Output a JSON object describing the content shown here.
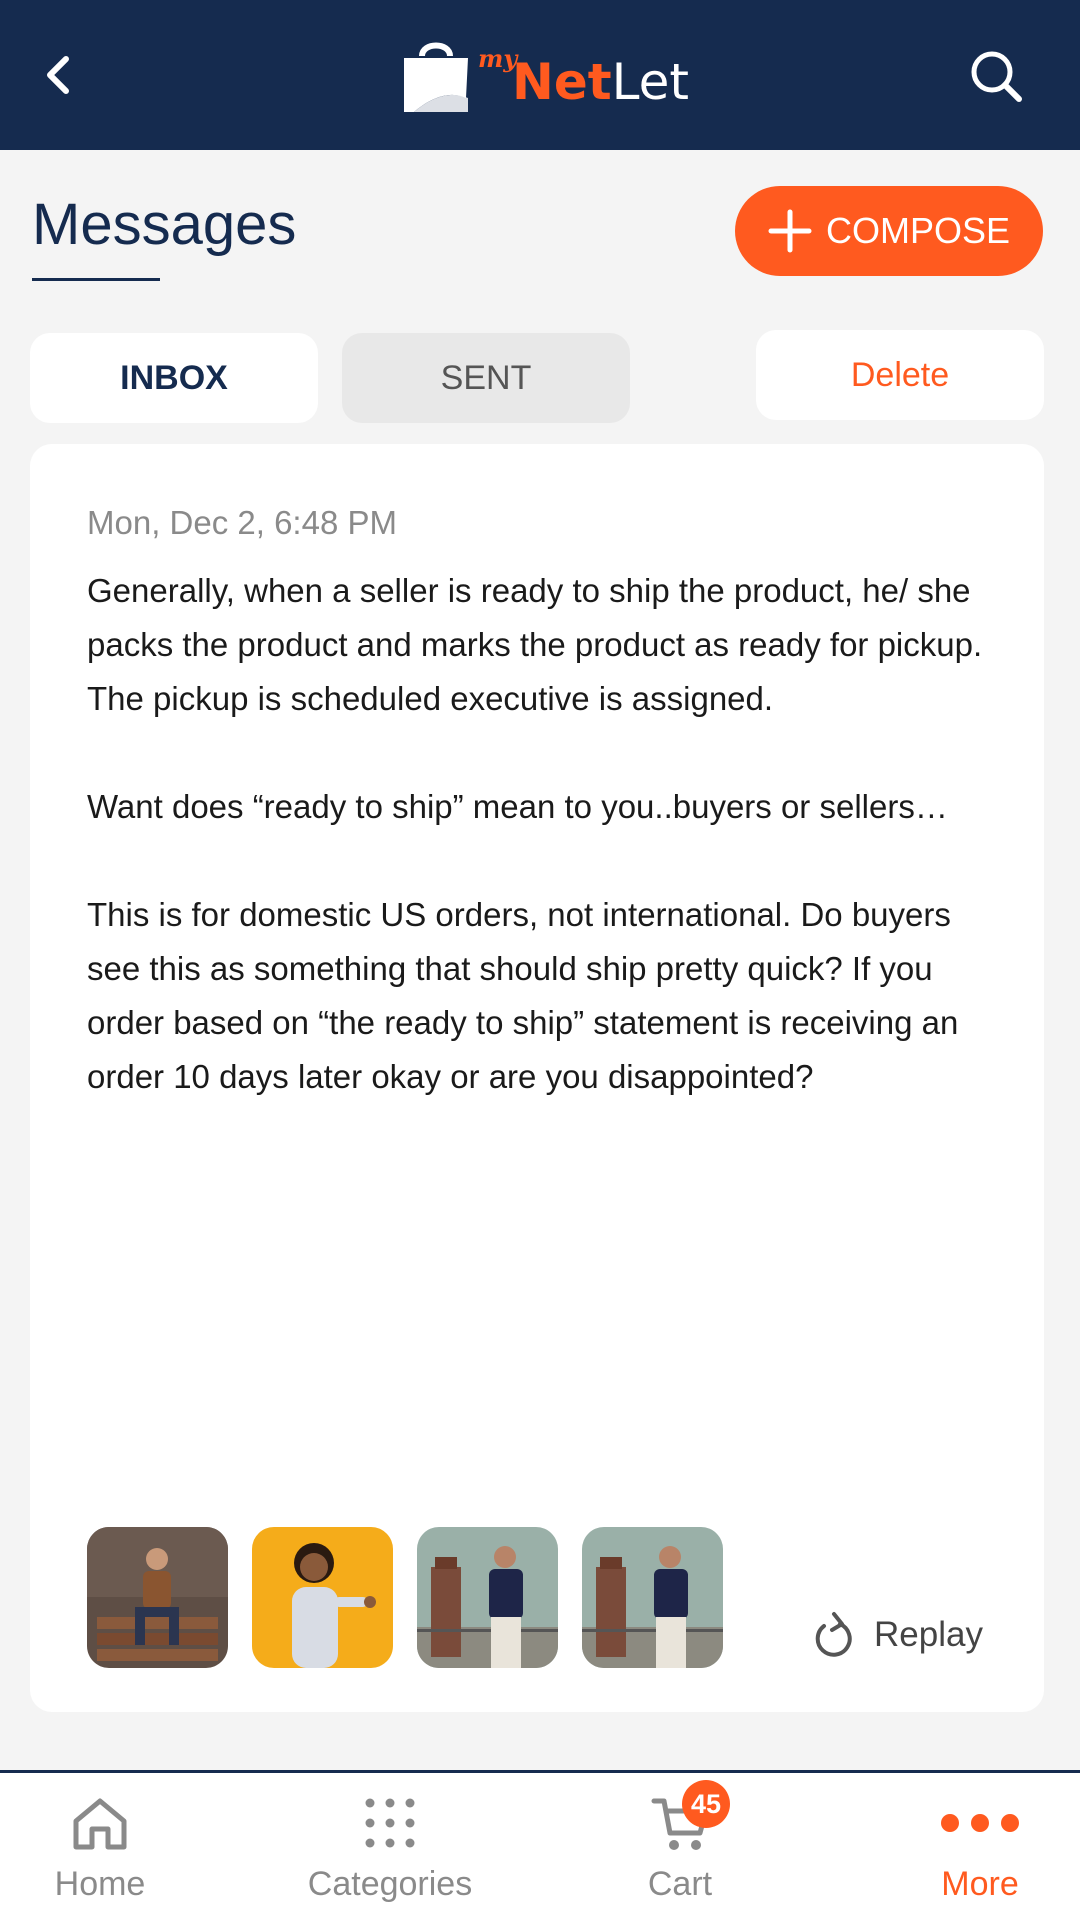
{
  "header": {
    "logo": {
      "prefix": "my",
      "brand_accent": "Net",
      "brand_rest": "Let"
    },
    "back_icon": "chevron-left-icon",
    "search_icon": "search-icon"
  },
  "page": {
    "title": "Messages",
    "compose_label": "COMPOSE"
  },
  "tabs": [
    {
      "label": "INBOX",
      "active": true
    },
    {
      "label": "SENT",
      "active": false
    }
  ],
  "delete_label": "Delete",
  "message": {
    "date": "Mon, Dec 2, 6:48 PM",
    "paragraphs": [
      "Generally, when a seller is ready to ship the product, he/ she packs the product and marks the product as ready for pickup. The pickup is scheduled executive is assigned.",
      "Want does “ready to ship” mean to you..buyers or sellers…",
      "This is for domestic US orders,  not international. Do buyers see this as something that should ship pretty quick? If you order based on “the ready to ship” statement is receiving an order 10 days later okay or are you disappointed?"
    ],
    "attachments": [
      {
        "icon": "man-sitting-photo"
      },
      {
        "icon": "man-pointing-yellow-photo"
      },
      {
        "icon": "man-tower-photo"
      },
      {
        "icon": "man-tower-photo"
      }
    ],
    "reply_label": "Replay"
  },
  "bottom_nav": {
    "home": "Home",
    "categories": "Categories",
    "cart": "Cart",
    "cart_count": "45",
    "more": "More"
  },
  "colors": {
    "header_bg": "#152b4f",
    "accent": "#ff5a1f",
    "background": "#f4f4f4"
  }
}
